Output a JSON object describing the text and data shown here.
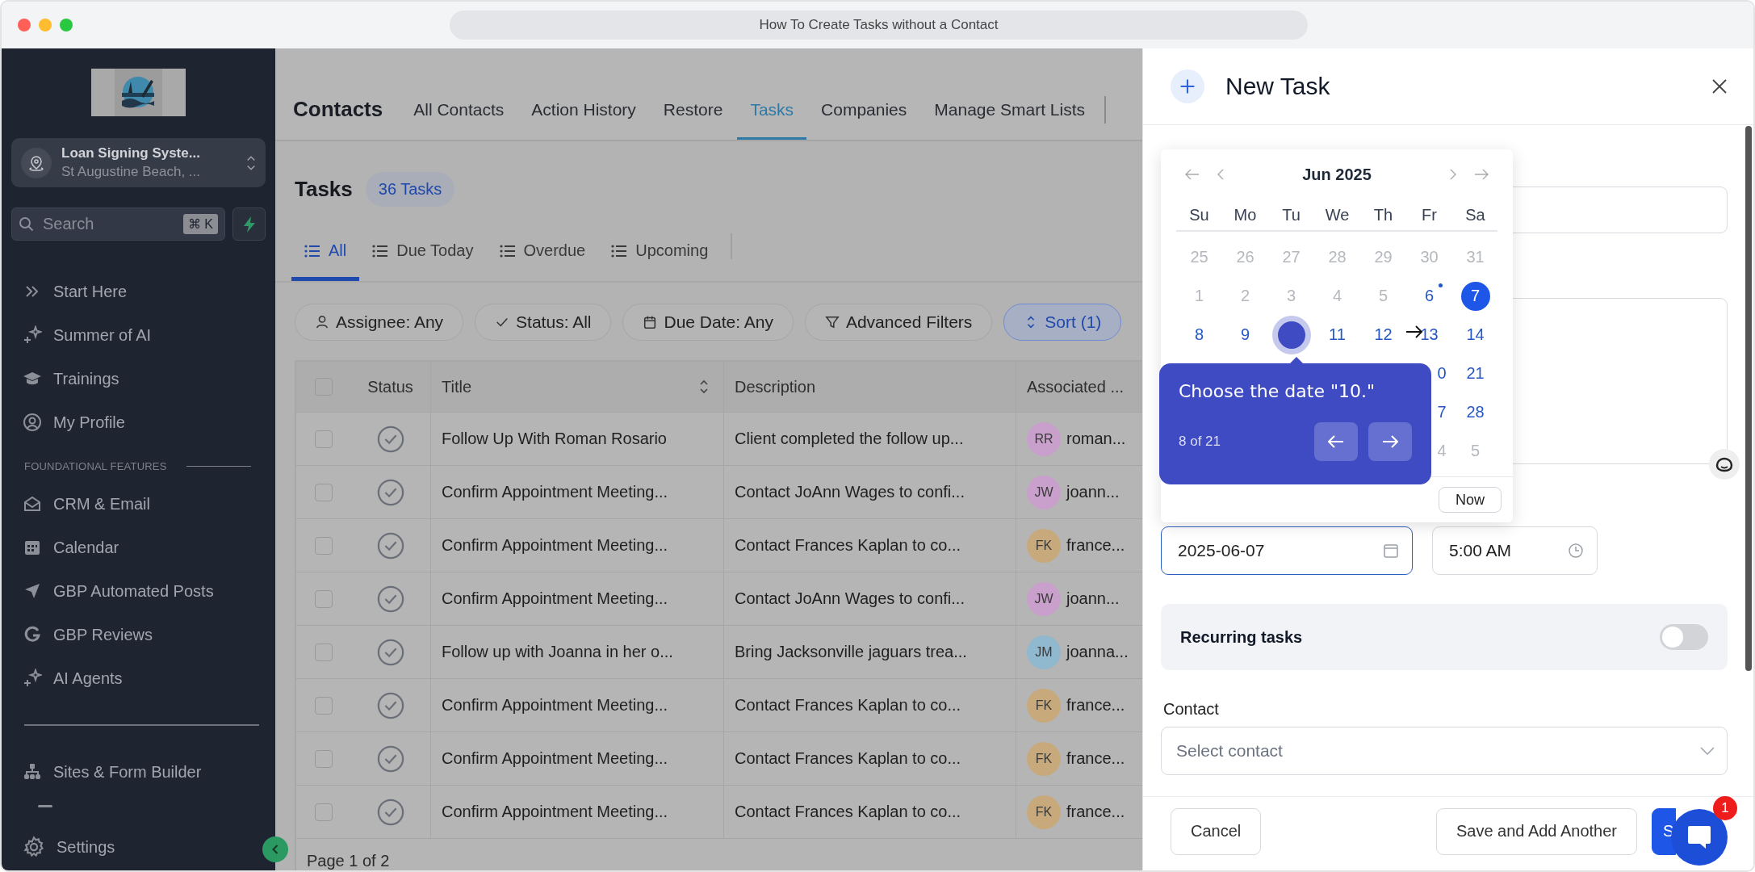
{
  "window": {
    "url": "How To Create Tasks without a Contact"
  },
  "sidebar": {
    "account": {
      "name": "Loan Signing Syste...",
      "location": "St Augustine Beach, ..."
    },
    "search": {
      "placeholder": "Search",
      "shortcut": "⌘ K"
    },
    "items": [
      {
        "label": "Start Here"
      },
      {
        "label": "Summer of AI"
      },
      {
        "label": "Trainings"
      },
      {
        "label": "My Profile"
      }
    ],
    "section": "FOUNDATIONAL FEATURES",
    "features": [
      {
        "label": "CRM & Email"
      },
      {
        "label": "Calendar"
      },
      {
        "label": "GBP Automated Posts"
      },
      {
        "label": "GBP Reviews"
      },
      {
        "label": "AI Agents"
      }
    ],
    "builder": [
      {
        "label": "Sites & Form Builder"
      }
    ],
    "settings": "Settings"
  },
  "main": {
    "title": "Contacts",
    "tabs": [
      {
        "label": "All Contacts",
        "selected": false
      },
      {
        "label": "Action History",
        "selected": false
      },
      {
        "label": "Restore",
        "selected": false
      },
      {
        "label": "Tasks",
        "selected": true
      },
      {
        "label": "Companies",
        "selected": false
      },
      {
        "label": "Manage Smart Lists",
        "selected": false
      }
    ],
    "heading": "Tasks",
    "count": "36 Tasks",
    "subtabs": [
      {
        "label": "All",
        "selected": true
      },
      {
        "label": "Due Today",
        "selected": false
      },
      {
        "label": "Overdue",
        "selected": false
      },
      {
        "label": "Upcoming",
        "selected": false
      }
    ],
    "filters": [
      {
        "label": "Assignee: Any",
        "active": false
      },
      {
        "label": "Status: All",
        "active": false
      },
      {
        "label": "Due Date: Any",
        "active": false
      },
      {
        "label": "Advanced Filters",
        "active": false
      },
      {
        "label": "Sort (1)",
        "active": true
      }
    ],
    "table": {
      "select_all": {
        "checked": false
      },
      "columns": [
        "Status",
        "Title",
        "Description",
        "Associated ..."
      ],
      "rows": [
        {
          "checked": false,
          "title": "Follow Up With Roman Rosario",
          "description": "Client completed the follow up...",
          "initials": "RR",
          "contact": "roman...",
          "color": "#c9a0cb"
        },
        {
          "checked": false,
          "title": "Confirm Appointment Meeting...",
          "description": "Contact JoAnn Wages to confi...",
          "initials": "JW",
          "contact": "joann...",
          "color": "#c9a0cb"
        },
        {
          "checked": false,
          "title": "Confirm Appointment Meeting...",
          "description": "Contact Frances Kaplan to co...",
          "initials": "FK",
          "contact": "france...",
          "color": "#c8a97c"
        },
        {
          "checked": false,
          "title": "Confirm Appointment Meeting...",
          "description": "Contact JoAnn Wages to confi...",
          "initials": "JW",
          "contact": "joann...",
          "color": "#c9a0cb"
        },
        {
          "checked": false,
          "title": "Follow up with Joanna in her o...",
          "description": "Bring Jacksonville jaguars trea...",
          "initials": "JM",
          "contact": "joanna...",
          "color": "#90b8cf"
        },
        {
          "checked": false,
          "title": "Confirm Appointment Meeting...",
          "description": "Contact Frances Kaplan to co...",
          "initials": "FK",
          "contact": "france...",
          "color": "#c8a97c"
        },
        {
          "checked": false,
          "title": "Confirm Appointment Meeting...",
          "description": "Contact Frances Kaplan to co...",
          "initials": "FK",
          "contact": "france...",
          "color": "#c8a97c"
        },
        {
          "checked": false,
          "title": "Confirm Appointment Meeting...",
          "description": "Contact Frances Kaplan to co...",
          "initials": "FK",
          "contact": "france...",
          "color": "#c8a97c"
        }
      ],
      "footer": "Page 1 of 2"
    }
  },
  "panel": {
    "title": "New Task",
    "calendar": {
      "month": "Jun 2025",
      "weekdays": [
        "Su",
        "Mo",
        "Tu",
        "We",
        "Th",
        "Fr",
        "Sa"
      ],
      "weeks": [
        [
          {
            "day": "25",
            "kind": "other"
          },
          {
            "day": "26",
            "kind": "other"
          },
          {
            "day": "27",
            "kind": "other"
          },
          {
            "day": "28",
            "kind": "other"
          },
          {
            "day": "29",
            "kind": "other"
          },
          {
            "day": "30",
            "kind": "other"
          },
          {
            "day": "31",
            "kind": "other"
          }
        ],
        [
          {
            "day": "1",
            "kind": "other"
          },
          {
            "day": "2",
            "kind": "other"
          },
          {
            "day": "3",
            "kind": "other"
          },
          {
            "day": "4",
            "kind": "other"
          },
          {
            "day": "5",
            "kind": "other"
          },
          {
            "day": "6",
            "kind": "today"
          },
          {
            "day": "7",
            "kind": "selected"
          }
        ],
        [
          {
            "day": "8",
            "kind": "current"
          },
          {
            "day": "9",
            "kind": "current"
          },
          {
            "kind": "hover"
          },
          {
            "day": "11",
            "kind": "current"
          },
          {
            "day": "12",
            "kind": "current"
          },
          {
            "day": "13",
            "kind": "current"
          },
          {
            "day": "14",
            "kind": "current"
          }
        ],
        [
          {
            "kind": "covered"
          },
          {
            "kind": "covered"
          },
          {
            "kind": "covered"
          },
          {
            "kind": "covered"
          },
          {
            "kind": "covered"
          },
          {
            "day": "0",
            "kind": "clip"
          },
          {
            "day": "21",
            "kind": "current"
          }
        ],
        [
          {
            "kind": "covered"
          },
          {
            "kind": "covered"
          },
          {
            "kind": "covered"
          },
          {
            "kind": "covered"
          },
          {
            "kind": "covered"
          },
          {
            "day": "7",
            "kind": "clip"
          },
          {
            "day": "28",
            "kind": "current"
          }
        ],
        [
          {
            "kind": "covered"
          },
          {
            "kind": "covered"
          },
          {
            "kind": "covered"
          },
          {
            "kind": "covered"
          },
          {
            "kind": "covered"
          },
          {
            "day": "4",
            "kind": "clipdim"
          },
          {
            "day": "5",
            "kind": "other"
          }
        ]
      ],
      "now": "Now"
    },
    "tour": {
      "text": "Choose the date \"10.\"",
      "step": "8 of 21"
    },
    "date": "2025-06-07",
    "time": "5:00 AM",
    "recurring": {
      "label": "Recurring tasks",
      "on": false
    },
    "contact": {
      "label": "Contact",
      "placeholder": "Select contact"
    },
    "buttons": {
      "cancel": "Cancel",
      "another": "Save and Add Another",
      "save": "S"
    },
    "chat_badge": "1"
  }
}
